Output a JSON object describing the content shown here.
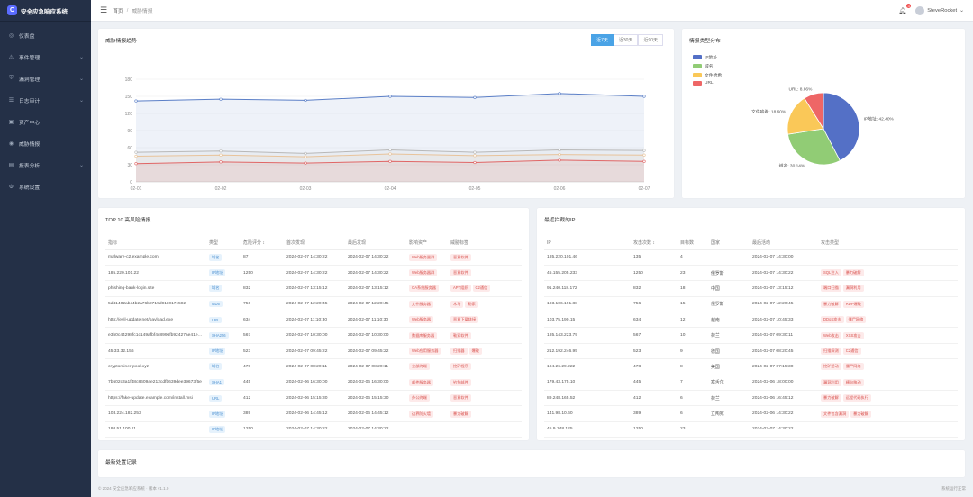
{
  "app": {
    "brand": "安全应急响应系统"
  },
  "nav": [
    {
      "icon": "dashboard-icon",
      "label": "仪表盘",
      "chev": ""
    },
    {
      "icon": "alert-icon",
      "label": "事件管理",
      "chev": "⌄"
    },
    {
      "icon": "shield-icon",
      "label": "漏洞管理",
      "chev": "⌄"
    },
    {
      "icon": "log-icon",
      "label": "日志审计",
      "chev": "⌄"
    },
    {
      "icon": "asset-icon",
      "label": "资产中心",
      "chev": ""
    },
    {
      "icon": "intel-icon",
      "label": "威胁情报",
      "chev": ""
    },
    {
      "icon": "report-icon",
      "label": "报表分析",
      "chev": "⌄"
    },
    {
      "icon": "gear-icon",
      "label": "系统设置",
      "chev": ""
    }
  ],
  "header": {
    "crumb_home": "首页",
    "crumb_sep": "/",
    "crumb_current": "威胁情报",
    "notify_count": "3",
    "username": "SteveRocket"
  },
  "trend": {
    "title": "威胁情报趋势",
    "tabs": [
      "近7天",
      "近30天",
      "近90天"
    ],
    "active_tab": 0
  },
  "pie": {
    "title": "情报类型分布"
  },
  "top10": {
    "title": "TOP 10 高风险情报",
    "columns": [
      "指标",
      "类型",
      "危险评分 ↕",
      "首次发现",
      "最后发现",
      "影响资产",
      "威胁标签"
    ],
    "rows": [
      [
        "malware-c2.example.com",
        "域名",
        "87",
        "2024-02-07 14:30:22",
        "2024-02-07 14:30:22",
        [
          "Web服务器群"
        ],
        [
          "恶意软件"
        ]
      ],
      [
        "185.220.101.22",
        "IP地址",
        "1250",
        "2024-02-07 14:30:22",
        "2024-02-07 14:30:22",
        [
          "Web服务器群"
        ],
        [
          "恶意软件"
        ]
      ],
      [
        "phishing-bank-login.site",
        "域名",
        "832",
        "2024-02-07 13:15:12",
        "2024-02-07 13:15:12",
        [
          "OA系统服务器"
        ],
        [
          "APT组织",
          "C2通信"
        ]
      ],
      [
        "5d41402abc4b2a76b9719d911017c592",
        "MD5",
        "756",
        "2024-02-07 12:20:45",
        "2024-02-07 12:20:45",
        [
          "文件服务器"
        ],
        [
          "木马",
          "勒索"
        ]
      ],
      [
        "http://evil-update.net/payload.exe",
        "URL",
        "634",
        "2024-02-07 11:10:30",
        "2024-02-07 11:10:30",
        [
          "Web服务器"
        ],
        [
          "恶意下载链接"
        ]
      ],
      [
        "e3b0c44298fc1c149afbf4c8996fb92427ae41e4649b934ca495991b7852b855",
        "SHA256",
        "567",
        "2024-02-07 10:30:00",
        "2024-02-07 10:30:00",
        [
          "数据库服务器"
        ],
        [
          "勒索软件"
        ]
      ],
      [
        "45.33.32.156",
        "IP地址",
        "523",
        "2024-02-07 09:45:22",
        "2024-02-07 09:45:22",
        [
          "Web应用服务器"
        ],
        [
          "扫描器",
          "爆破"
        ]
      ],
      [
        "cryptominer-pool.xyz",
        "域名",
        "478",
        "2024-02-07 08:20:11",
        "2024-02-07 08:20:11",
        [
          "全部终端"
        ],
        [
          "挖矿程序"
        ]
      ],
      [
        "7b502c3a1f48c8609ae212cdfb639dee39673f5e",
        "SHA1",
        "445",
        "2024-02-06 16:30:00",
        "2024-02-06 16:30:00",
        [
          "邮件服务器"
        ],
        [
          "钓鱼邮件"
        ]
      ],
      [
        "https://fake-update.example.com/install.msi",
        "URL",
        "412",
        "2024-02-06 15:15:30",
        "2024-02-06 15:15:30",
        [
          "办公终端"
        ],
        [
          "恶意软件"
        ]
      ],
      [
        "103.224.182.253",
        "IP地址",
        "389",
        "2024-02-06 14:45:12",
        "2024-02-06 14:45:12",
        [
          "边界防火墙"
        ],
        [
          "暴力破解"
        ]
      ],
      [
        "198.51.100.11",
        "IP地址",
        "1250",
        "2024-02-07 14:30:22",
        "2024-02-07 14:30:22",
        [],
        []
      ]
    ]
  },
  "recent": {
    "title": "最近拦截的IP",
    "columns": [
      "IP",
      "攻击次数 ↕",
      "目标数",
      "国家",
      "最后活动",
      "攻击类型"
    ],
    "rows": [
      [
        "185.220.101.46",
        "135",
        "4",
        "",
        "2024-02-07 14:30:00",
        []
      ],
      [
        "45.155.205.233",
        "1250",
        "23",
        "俄罗斯",
        "2024-02-07 14:30:22",
        [
          "SQL注入",
          "暴力破解"
        ]
      ],
      [
        "91.240.118.172",
        "832",
        "18",
        "中国",
        "2024-02-07 13:15:12",
        [
          "端口扫描",
          "漏洞利用"
        ]
      ],
      [
        "193.106.191.88",
        "756",
        "15",
        "俄罗斯",
        "2024-02-07 12:20:45",
        [
          "暴力破解",
          "RDP爆破"
        ]
      ],
      [
        "103.75.190.15",
        "634",
        "12",
        "越南",
        "2024-02-07 10:45:33",
        [
          "DDoS攻击",
          "僵尸网络"
        ]
      ],
      [
        "185.143.223.79",
        "567",
        "10",
        "荷兰",
        "2024-02-07 09:30:11",
        [
          "Web攻击",
          "XSS攻击"
        ]
      ],
      [
        "212.192.246.95",
        "523",
        "9",
        "德国",
        "2024-02-07 08:20:45",
        [
          "扫描探测",
          "C2通信"
        ]
      ],
      [
        "194.26.29.222",
        "478",
        "8",
        "美国",
        "2024-02-07 07:15:30",
        [
          "挖矿活动",
          "僵尸网络"
        ]
      ],
      [
        "179.43.175.10",
        "445",
        "7",
        "塞舌尔",
        "2024-02-06 18:00:00",
        [
          "漏洞利用",
          "横向移动"
        ]
      ],
      [
        "89.248.165.52",
        "412",
        "6",
        "荷兰",
        "2024-02-06 16:45:12",
        [
          "暴力破解",
          "远程代码执行"
        ]
      ],
      [
        "141.98.10.60",
        "389",
        "6",
        "立陶宛",
        "2024-02-06 14:30:22",
        [
          "文件包含漏洞",
          "暴力破解"
        ]
      ],
      [
        "45.9.148.125",
        "1250",
        "23",
        "",
        "2024-02-07 14:30:22",
        []
      ]
    ]
  },
  "bottom": {
    "title": "最新处置记录"
  },
  "footer": {
    "left": "© 2024 安全应急响应系统 · 版本 v1.1.0",
    "right": "系统运行正常"
  },
  "colors": {
    "sidebar_bg": "#243047",
    "accent": "#4aa3e6",
    "tag_blue_bg": "#e6f2fc",
    "tag_red_bg": "#fdeaea"
  },
  "chart_data": [
    {
      "type": "area",
      "title": "",
      "ylabel": "",
      "ylim": [
        0,
        180
      ],
      "yticks": [
        0,
        30,
        60,
        90,
        120,
        150,
        180
      ],
      "x": [
        "02-01",
        "02-02",
        "02-03",
        "02-04",
        "02-05",
        "02-06",
        "02-07"
      ],
      "legend_position": "top-center",
      "series": [
        {
          "name": "",
          "color": "#5b7fc7",
          "values": [
            142,
            145,
            143,
            150,
            148,
            155,
            150
          ]
        },
        {
          "name": "",
          "color": "#b8b8b8",
          "values": [
            52,
            54,
            50,
            56,
            52,
            56,
            55
          ]
        },
        {
          "name": "",
          "color": "#e8c39a",
          "values": [
            45,
            47,
            44,
            49,
            46,
            48,
            47
          ]
        },
        {
          "name": "",
          "color": "#e06666",
          "values": [
            32,
            35,
            33,
            36,
            34,
            38,
            36
          ]
        }
      ]
    },
    {
      "type": "pie",
      "title": "",
      "legend_position": "top-left",
      "slices": [
        {
          "name": "IP地址",
          "label": "IP地址: 42.40%",
          "value": 42.4,
          "color": "#5470c6"
        },
        {
          "name": "域名",
          "label": "域名: 30.14%",
          "value": 30.14,
          "color": "#91cc75"
        },
        {
          "name": "文件哈希",
          "label": "文件哈希: 18.60%",
          "value": 18.6,
          "color": "#fac858"
        },
        {
          "name": "URL",
          "label": "URL: 8.86%",
          "value": 8.86,
          "color": "#ee6666"
        }
      ]
    }
  ]
}
